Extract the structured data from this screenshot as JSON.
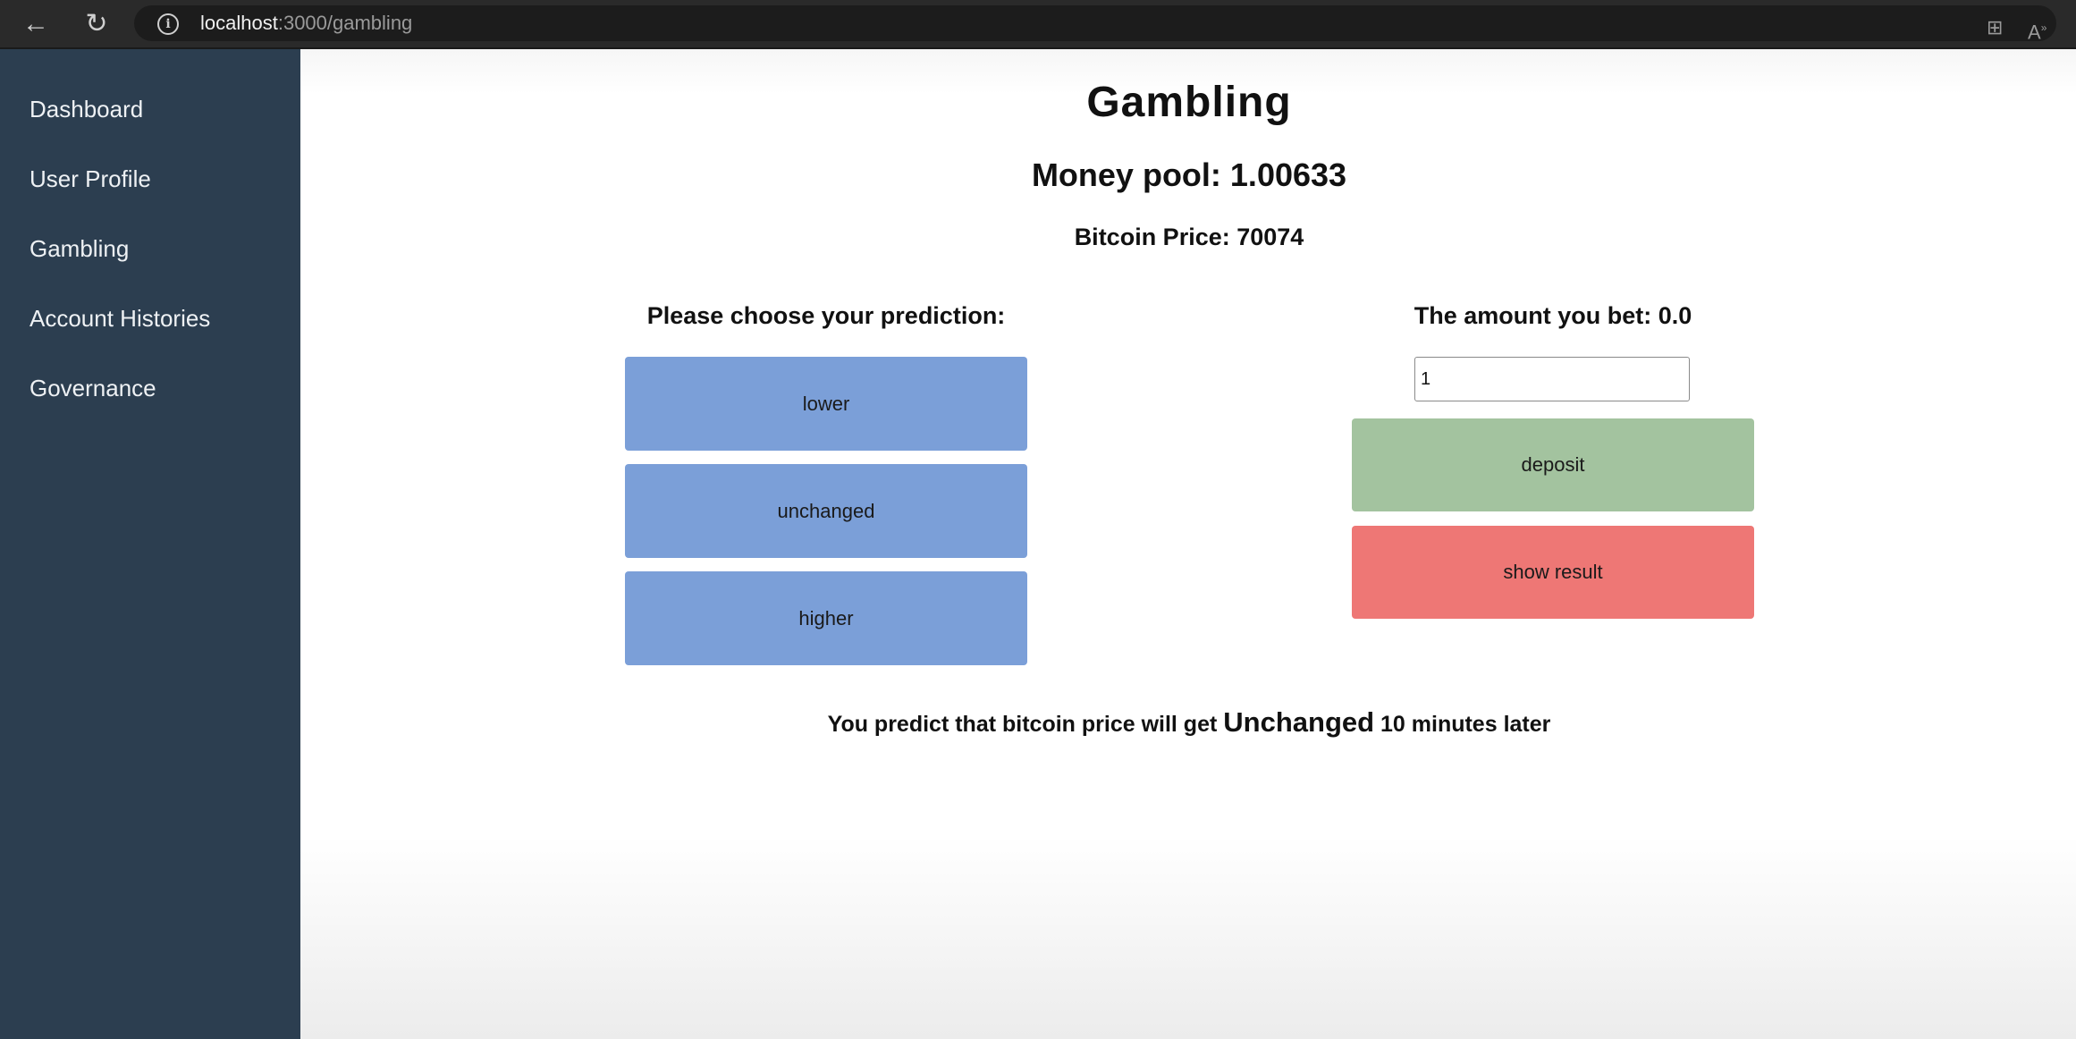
{
  "browser": {
    "url_host": "localhost",
    "url_path": ":3000/gambling",
    "icons": {
      "back": "back-arrow-icon",
      "reload": "reload-icon",
      "info": "info-icon",
      "split_screen": "split-screen-icon",
      "read_aloud": "read-aloud-icon"
    }
  },
  "sidebar": {
    "items": [
      {
        "label": "Dashboard"
      },
      {
        "label": "User Profile"
      },
      {
        "label": "Gambling"
      },
      {
        "label": "Account Histories"
      },
      {
        "label": "Governance"
      }
    ]
  },
  "main": {
    "title": "Gambling",
    "money_pool": "Money pool: 1.00633",
    "bitcoin_price": "Bitcoin Price: 70074",
    "prediction_heading": "Please choose your prediction:",
    "prediction_buttons": [
      {
        "label": "lower"
      },
      {
        "label": "unchanged"
      },
      {
        "label": "higher"
      }
    ],
    "bet_heading": "The amount you bet: 0.0",
    "bet_input_value": "1",
    "deposit_label": "deposit",
    "show_result_label": "show result",
    "prediction_text": {
      "prefix": "You predict that bitcoin price will get",
      "choice": "Unchanged",
      "suffix": "10 minutes later"
    }
  },
  "colors": {
    "sidebar_bg": "#2c3e50",
    "prediction_button": "#7b9fd8",
    "deposit_button": "#a3c39f",
    "show_result_button": "#ee7775"
  }
}
